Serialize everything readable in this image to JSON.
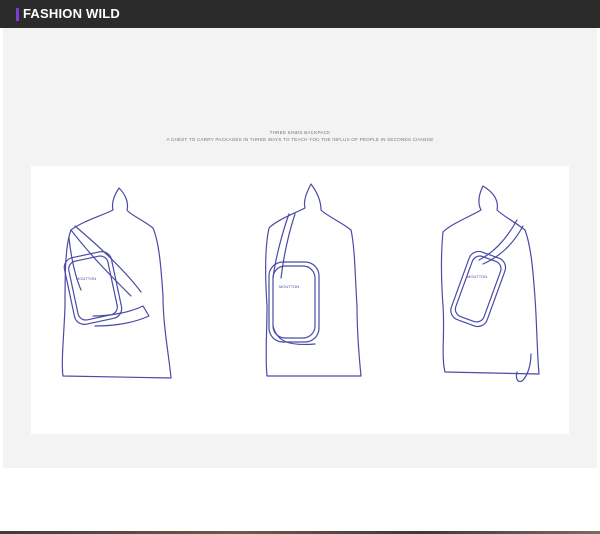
{
  "header": {
    "title": "FASHION WILD",
    "accent_color": "#7a3fd1",
    "background": "#2b2b2b"
  },
  "content": {
    "caption_line1": "THREE KINDS BACKPACK",
    "caption_line2": "A CHEST TO CARRY PACKAGES IN THREE WAYS TO TEACH YOU THE INFLUX OF PEOPLE IN SECONDS CHANGE"
  },
  "illustrations": [
    {
      "name": "diagonal-carry"
    },
    {
      "name": "single-shoulder-carry"
    },
    {
      "name": "chest-carry"
    }
  ],
  "colors": {
    "outline": "#4b4aa6",
    "panel": "#f3f3f3"
  }
}
